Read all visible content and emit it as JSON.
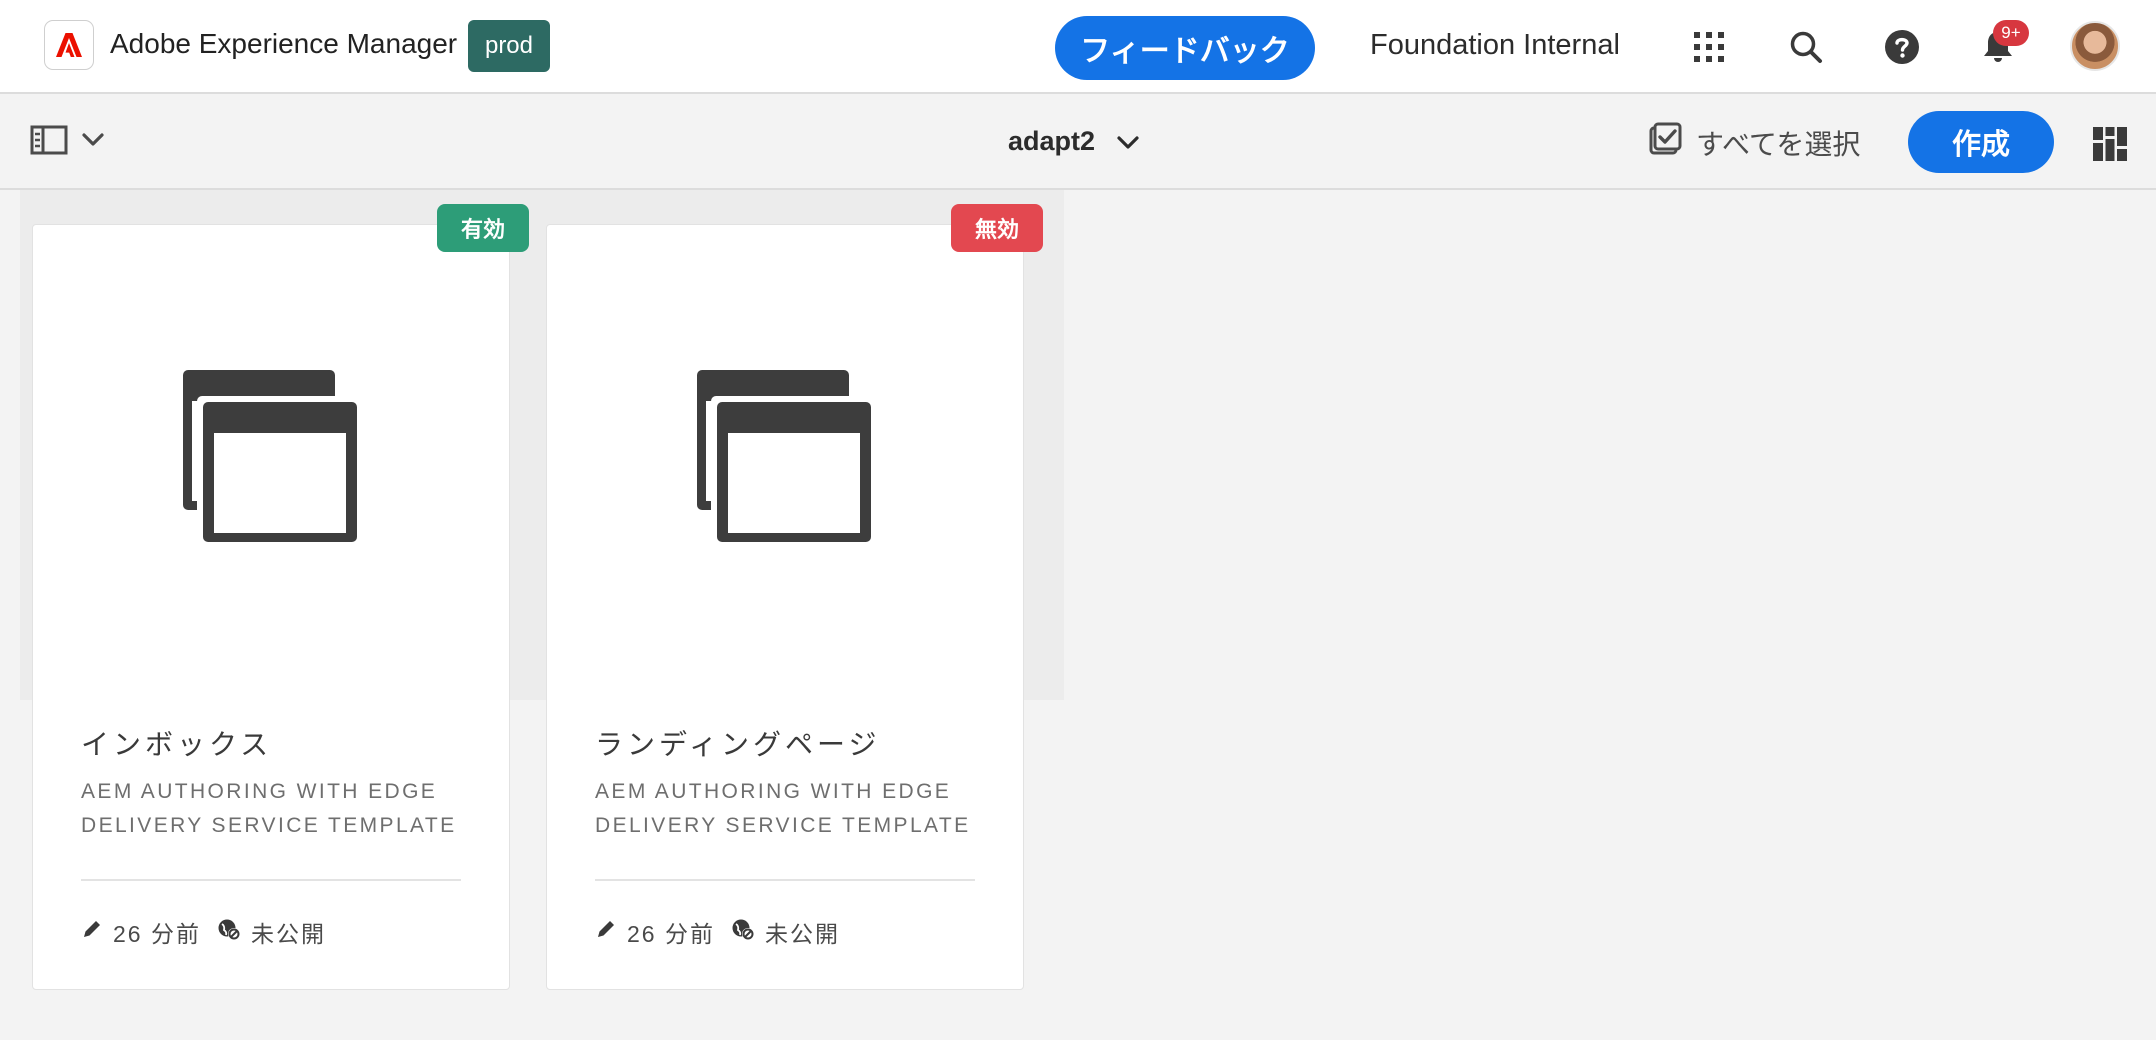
{
  "header": {
    "app_title": "Adobe Experience Manager",
    "environment": "prod",
    "feedback_label": "フィードバック",
    "org_name": "Foundation Internal",
    "notifications_count": "9+"
  },
  "toolbar": {
    "folder_title": "adapt2",
    "select_all_label": "すべてを選択",
    "create_label": "作成"
  },
  "cards": [
    {
      "title": "インボックス",
      "subtitle": "AEM AUTHORING WITH EDGE DELIVERY SERVICE TEMPLATE",
      "status": "有効",
      "status_color": "#2d9d78",
      "modified": "26 分前",
      "publish_state": "未公開"
    },
    {
      "title": "ランディングページ",
      "subtitle": "AEM AUTHORING WITH EDGE DELIVERY SERVICE TEMPLATE",
      "status": "無効",
      "status_color": "#e34850",
      "modified": "26 分前",
      "publish_state": "未公開"
    }
  ],
  "colors": {
    "accent": "#1473e6",
    "env_badge": "#2d6a63"
  }
}
